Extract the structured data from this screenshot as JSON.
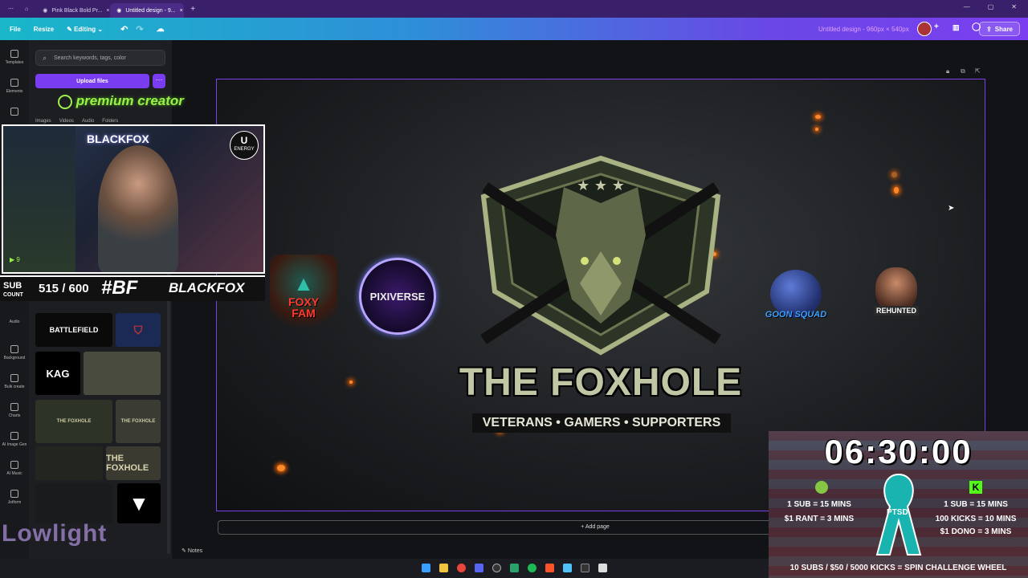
{
  "browser": {
    "tabs": [
      {
        "label": "Pink Black Bold Pr..."
      },
      {
        "label": "Untitled design - 9..."
      }
    ],
    "new_tab": "+"
  },
  "toolbar": {
    "file": "File",
    "resize": "Resize",
    "editing": "Editing",
    "doc_title": "Untitled design - 960px × 540px",
    "share": "Share"
  },
  "rail": {
    "items": [
      "Templates",
      "Elements",
      "Text",
      "Audio",
      "Background",
      "Bulk create",
      "Charts",
      "AI Image Gen",
      "AI Music",
      "Jotform"
    ]
  },
  "panel": {
    "search_placeholder": "Search keywords, tags, color",
    "upload": "Upload files",
    "tabs": [
      "Images",
      "Videos",
      "Audio",
      "Folders"
    ],
    "thumbs": [
      "BATTLEFIELD",
      "KAG",
      "THE FOXHOLE",
      "THE FOXHOLE",
      "THE FOXHOLE"
    ]
  },
  "overlay": {
    "premium": "premium creator",
    "cam_sign": "BLACKFOX",
    "energy": "ENERGY",
    "sub_label_1": "SUB",
    "sub_label_2": "COUNT",
    "sub_count": "515 / 600",
    "brand": "BLACKFOX",
    "lowlight": "Lowlight"
  },
  "design": {
    "main_title": "THE FOXHOLE",
    "tagline": "VETERANS • GAMERS • SUPPORTERS",
    "logos": [
      "FOXY FAM",
      "PIXIVERSE",
      "GOON SQUAD",
      "REHUNTED"
    ]
  },
  "canvas": {
    "add_page": "+ Add page",
    "notes": "Notes"
  },
  "timer": {
    "clock": "06:30:00",
    "left_lines": [
      "1 SUB = 15 MINS",
      "$1 RANT = 3 MINS"
    ],
    "right_lines": [
      "1 SUB = 15 MINS",
      "100 KICKS = 10 MINS",
      "$1 DONO = 3 MINS"
    ],
    "center_label": "PTSD",
    "footer": "10 SUBS / $50 / 5000 KICKS = SPIN CHALLENGE WHEEL"
  },
  "colors": {
    "accent": "#7b3ff0",
    "rumble_green": "#85c742",
    "kick_green": "#53fc18",
    "ribbon": "#19b3b0",
    "ember": "#ff8a2a"
  }
}
